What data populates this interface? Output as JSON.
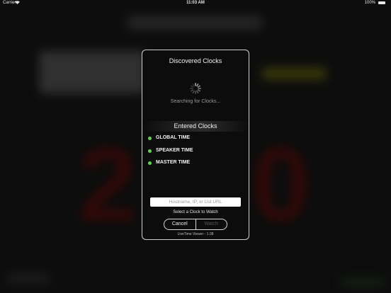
{
  "status_bar": {
    "carrier": "Carrier",
    "time": "11:03 AM",
    "battery_percent": "100%"
  },
  "dialog": {
    "title": "Discovered Clocks",
    "searching_text": "Searching for Clocks...",
    "entered_header": "Entered Clocks",
    "clocks": [
      {
        "label": "GLOBAL TIME",
        "status_color": "#5ad64a"
      },
      {
        "label": "SPEAKER TIME",
        "status_color": "#5ad64a"
      },
      {
        "label": "MASTER TIME",
        "status_color": "#5ad64a"
      }
    ],
    "host_input": {
      "value": "",
      "placeholder": "Hostname, IP, or List URL"
    },
    "select_text": "Select a Clock to Watch",
    "cancel_label": "Cancel",
    "watch_label": "Watch",
    "version_text": "LiveTime Viewer - 1.08"
  },
  "background": {
    "digit_left": "2",
    "digit_right": "0",
    "digit_color": "#4a0e0e"
  }
}
